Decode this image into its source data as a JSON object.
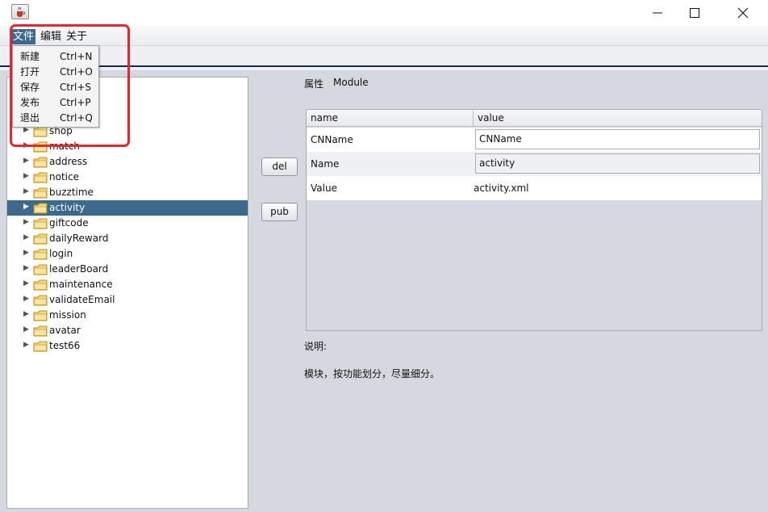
{
  "window": {
    "icon": "java-cup-icon",
    "controls": [
      "minimize-icon",
      "maximize-icon",
      "close-icon"
    ]
  },
  "menubar": {
    "items": [
      "文件",
      "编辑",
      "关于"
    ]
  },
  "file_menu": {
    "items": [
      {
        "label": "新建",
        "shortcut": "Ctrl+N"
      },
      {
        "label": "打开",
        "shortcut": "Ctrl+O"
      },
      {
        "label": "保存",
        "shortcut": "Ctrl+S"
      },
      {
        "label": "发布",
        "shortcut": "Ctrl+P"
      },
      {
        "label": "退出",
        "shortcut": "Ctrl+Q"
      }
    ]
  },
  "tree": {
    "nodes": [
      "shop",
      "match",
      "address",
      "notice",
      "buzztime",
      "activity",
      "giftcode",
      "dailyReward",
      "login",
      "leaderBoard",
      "maintenance",
      "validateEmail",
      "mission",
      "avatar",
      "test66"
    ],
    "selected": "activity"
  },
  "buttons": {
    "del": "del",
    "pub": "pub"
  },
  "properties": {
    "label": "属性",
    "type": "Module",
    "columns": [
      "name",
      "value"
    ],
    "rows": [
      {
        "name": "CNName",
        "value": "CNName"
      },
      {
        "name": "Name",
        "value": "activity"
      },
      {
        "name": "Value",
        "value": "activity.xml"
      }
    ]
  },
  "description": {
    "label": "说明:",
    "text": "模块，按功能划分，尽量细分。"
  },
  "colors": {
    "selection": "#3c6a8e",
    "highlight_box": "#e0282e",
    "panel_bg": "#d5d9df"
  }
}
